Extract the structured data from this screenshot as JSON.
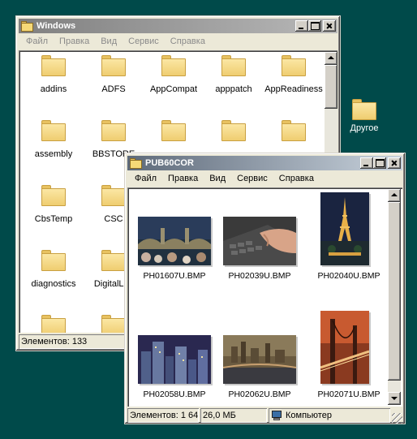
{
  "desktop": {
    "folder_label": "Другое"
  },
  "windows_window": {
    "title": "Windows",
    "menu": [
      "Файл",
      "Правка",
      "Вид",
      "Сервис",
      "Справка"
    ],
    "folders": [
      "addins",
      "ADFS",
      "AppCompat",
      "apppatch",
      "AppReadiness",
      "assembly",
      "BBSTORE",
      "",
      "",
      "",
      "CbsTemp",
      "CSC",
      "",
      "",
      "",
      "diagnostics",
      "DigitalLoc",
      "",
      "",
      "",
      "",
      "",
      "",
      "",
      ""
    ],
    "status": {
      "items": "Элементов: 133"
    }
  },
  "pub_window": {
    "title": "PUB60COR",
    "menu": [
      "Файл",
      "Правка",
      "Вид",
      "Сервис",
      "Справка"
    ],
    "thumbnails": [
      {
        "name": "PH01607U.BMP",
        "icon": "bridge-photo"
      },
      {
        "name": "PH02039U.BMP",
        "icon": "keyboard-photo"
      },
      {
        "name": "PH02040U.BMP",
        "icon": "eiffel-tower-photo"
      },
      {
        "name": "PH02058U.BMP",
        "icon": "city-night-photo"
      },
      {
        "name": "PH02062U.BMP",
        "icon": "city-river-photo"
      },
      {
        "name": "PH02071U.BMP",
        "icon": "golden-gate-photo"
      }
    ],
    "status": {
      "items": "Элементов: 1 64",
      "size": "26,0 МБ",
      "location": "Компьютер"
    }
  }
}
